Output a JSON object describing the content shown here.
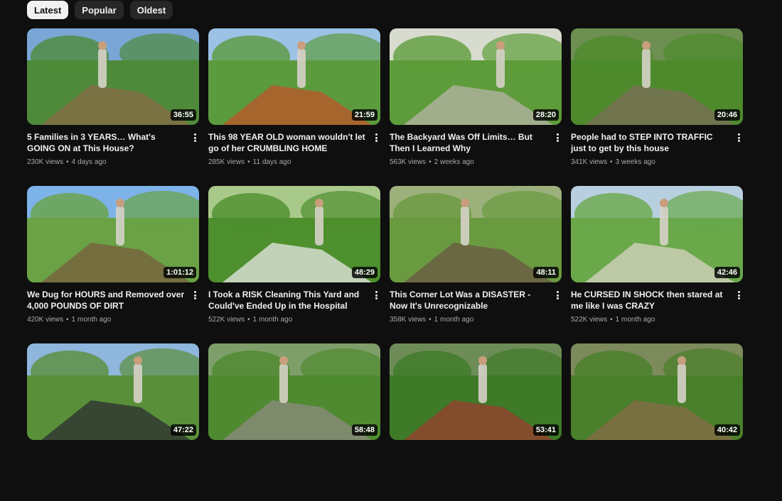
{
  "filters": [
    "Latest",
    "Popular",
    "Oldest"
  ],
  "active_filter": "Latest",
  "videos": [
    {
      "title": "5 Families in 3 YEARS… What's GOING ON at This House?",
      "views": "230K views",
      "age": "4 days ago",
      "duration": "36:55",
      "palette": [
        "#7aa6d6",
        "#4f8a3a",
        "#8a6a48"
      ]
    },
    {
      "title": "This 98 YEAR OLD woman wouldn't let go of her CRUMBLING HOME",
      "views": "285K views",
      "age": "11 days ago",
      "duration": "21:59",
      "palette": [
        "#9cc2e6",
        "#5c9a3e",
        "#c0532a"
      ]
    },
    {
      "title": "The Backyard Was Off Limits… But Then I Learned Why",
      "views": "563K views",
      "age": "2 weeks ago",
      "duration": "28:20",
      "palette": [
        "#d8dccf",
        "#5e9c3b",
        "#b8b4a8"
      ]
    },
    {
      "title": "People had to STEP INTO TRAFFIC just to get by this house",
      "views": "341K views",
      "age": "3 weeks ago",
      "duration": "20:46",
      "palette": [
        "#6d8f52",
        "#4e8a2c",
        "#7d6e5a"
      ]
    },
    {
      "title": "We Dug for HOURS and Removed over 4,000 POUNDS OF DIRT",
      "views": "420K views",
      "age": "1 month ago",
      "duration": "1:01:12",
      "palette": [
        "#7db3e8",
        "#6aa245",
        "#7a5c3e"
      ]
    },
    {
      "title": "I Took a RISK Cleaning This Yard and Could've Ended Up in the Hospital",
      "views": "522K views",
      "age": "1 month ago",
      "duration": "48:29",
      "palette": [
        "#a9c98a",
        "#4e8f2e",
        "#e8e8e8"
      ]
    },
    {
      "title": "This Corner Lot Was a DISASTER - Now It's Unrecognizable",
      "views": "358K views",
      "age": "1 month ago",
      "duration": "48:11",
      "palette": [
        "#9bb07a",
        "#6a9a40",
        "#6b5743"
      ]
    },
    {
      "title": "He CURSED IN SHOCK then stared at me like I was CRAZY",
      "views": "522K views",
      "age": "1 month ago",
      "duration": "42:46",
      "palette": [
        "#b8cfe0",
        "#6aa84a",
        "#d9d4c4"
      ]
    },
    {
      "title": "",
      "views": "",
      "age": "",
      "duration": "47:22",
      "palette": [
        "#8fb6dc",
        "#5a8f3a",
        "#2b2d30"
      ]
    },
    {
      "title": "",
      "views": "",
      "age": "",
      "duration": "58:48",
      "palette": [
        "#7f9f6a",
        "#4f8a30",
        "#8e8a80"
      ]
    },
    {
      "title": "",
      "views": "",
      "age": "",
      "duration": "53:41",
      "palette": [
        "#6e8c58",
        "#3f7a28",
        "#9b3e2e"
      ]
    },
    {
      "title": "",
      "views": "",
      "age": "",
      "duration": "40:42",
      "palette": [
        "#7d8a5c",
        "#4a7f2b",
        "#8a6b4a"
      ]
    }
  ]
}
